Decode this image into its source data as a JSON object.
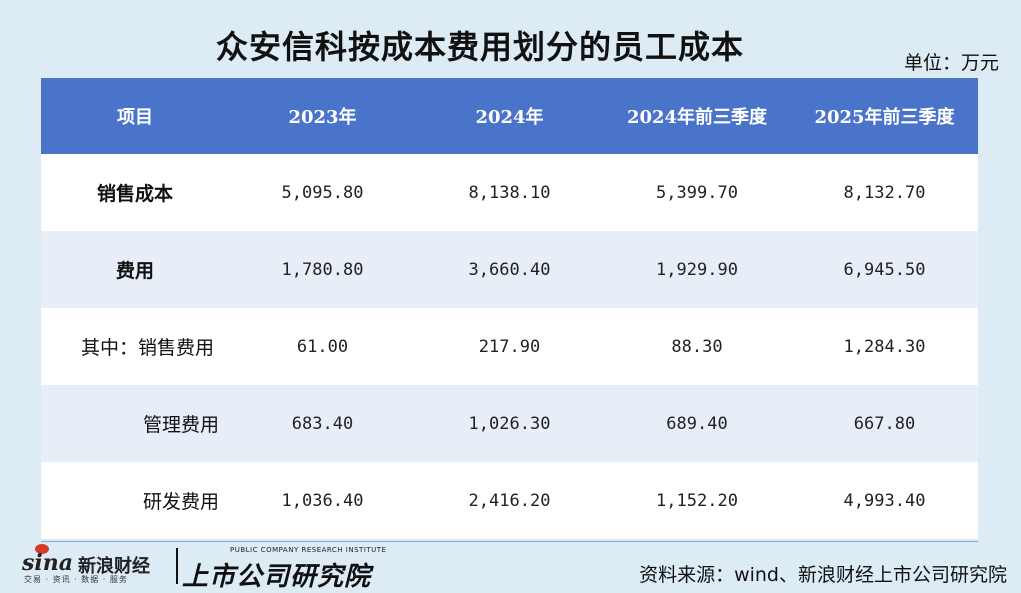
{
  "title": "众安信科按成本费用划分的员工成本",
  "unit": "单位：万元",
  "table": {
    "headers": [
      "项目",
      "2023年",
      "2024年",
      "2024年前三季度",
      "2025年前三季度"
    ],
    "rows": [
      {
        "label": "销售成本",
        "values": [
          "5,095.80",
          "8,138.10",
          "5,399.70",
          "8,132.70"
        ]
      },
      {
        "label": "费用",
        "values": [
          "1,780.80",
          "3,660.40",
          "1,929.90",
          "6,945.50"
        ]
      },
      {
        "label": "其中：销售费用",
        "values": [
          "61.00",
          "217.90",
          "88.30",
          "1,284.30"
        ]
      },
      {
        "label": "管理费用",
        "values": [
          "683.40",
          "1,026.30",
          "689.40",
          "667.80"
        ]
      },
      {
        "label": "研发费用",
        "values": [
          "1,036.40",
          "2,416.20",
          "1,152.20",
          "4,993.40"
        ]
      }
    ]
  },
  "footer": {
    "sina_logo": "sina",
    "sina_name": "新浪财经",
    "sina_tagline": "交易 · 资讯 · 数据 · 服务",
    "listed_logo_en": "PUBLIC COMPANY RESEARCH INSTITUTE",
    "listed_logo_cn": "上市公司研究院",
    "source": "资料来源：wind、新浪财经上市公司研究院"
  },
  "colors": {
    "header_bg": "#4a74c9",
    "page_bg": "#dcebf4",
    "row_alt": "#e8eef8"
  }
}
